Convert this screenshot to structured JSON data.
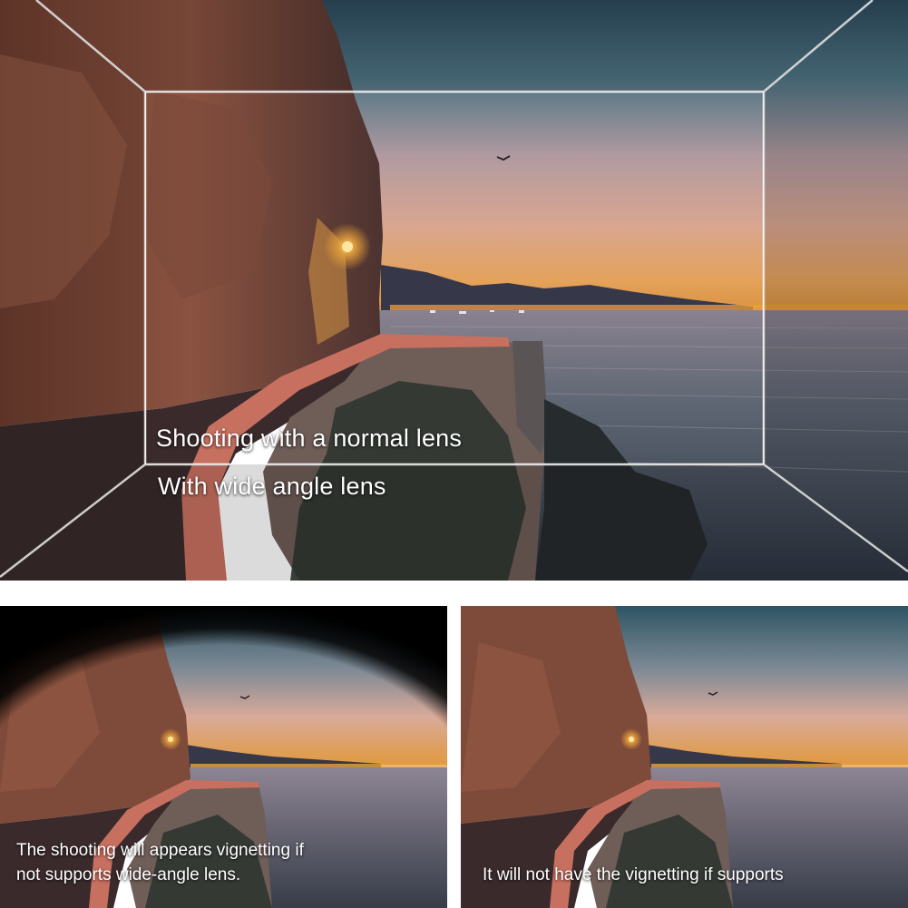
{
  "top_panel": {
    "normal_lens_caption": "Shooting with a normal lens",
    "wide_lens_caption": "With wide angle lens"
  },
  "bottom_left_panel": {
    "caption_line1": "The shooting will appears vignetting if",
    "caption_line2": "not supports wide-angle lens."
  },
  "bottom_right_panel": {
    "caption": "It will not have the vignetting if supports"
  }
}
